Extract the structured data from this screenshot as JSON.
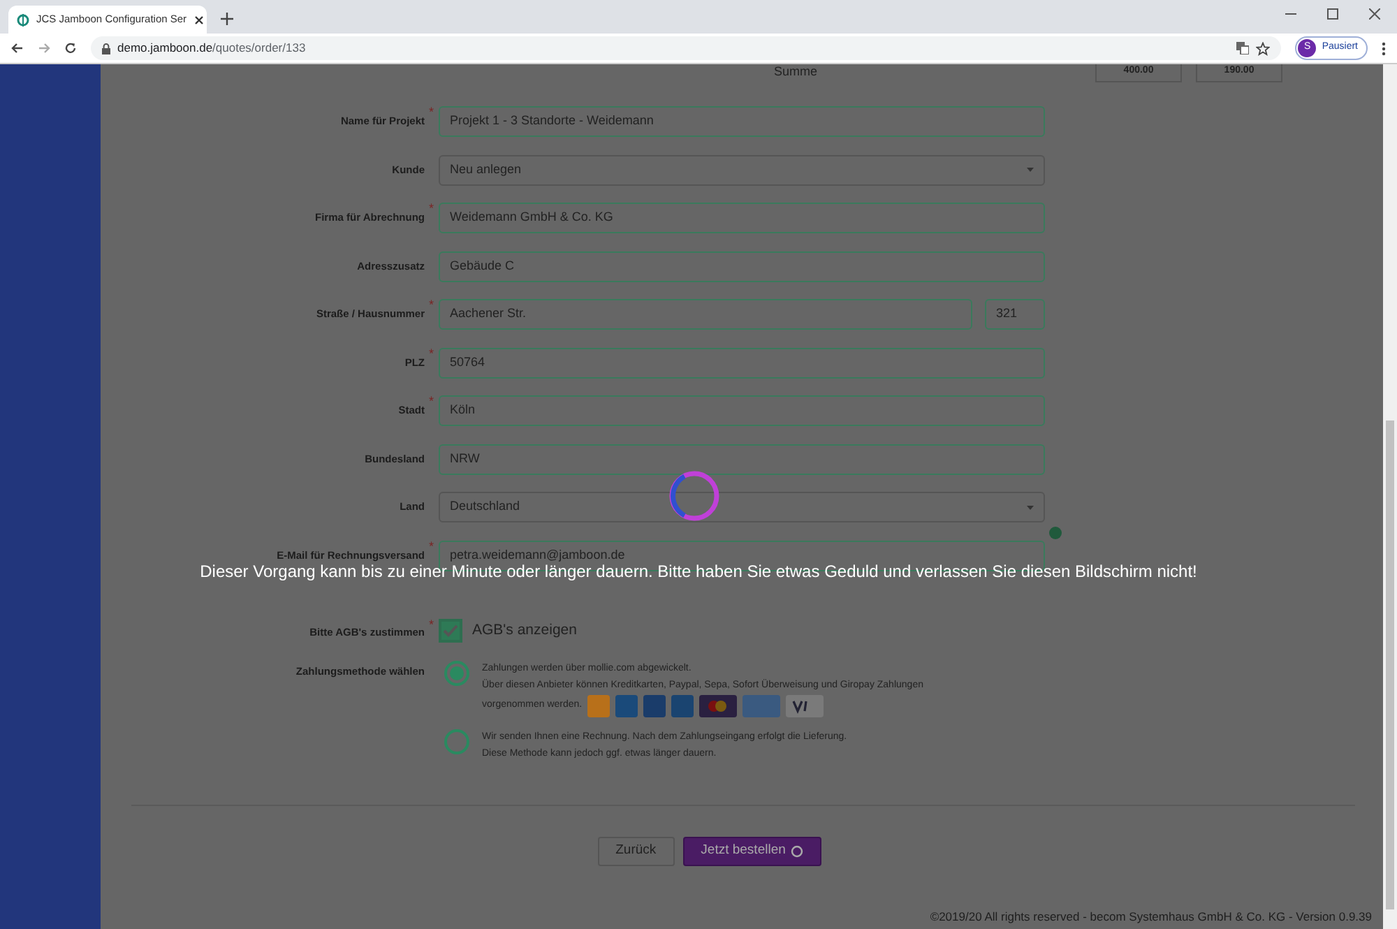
{
  "browser": {
    "tab_title": "JCS Jamboon Configuration Ser",
    "url_host": "demo.jamboon.de",
    "url_path": "/quotes/order/133",
    "profile_initial": "S",
    "profile_status": "Pausiert"
  },
  "required_mark": "*",
  "summary": {
    "label": "Summe",
    "values": [
      "400.00",
      "190.00"
    ]
  },
  "fields": [
    {
      "kind": "text",
      "label": "Name für Projekt",
      "required": true,
      "value": "Projekt 1 - 3 Standorte - Weidemann"
    },
    {
      "kind": "select",
      "label": "Kunde",
      "required": false,
      "value": "Neu anlegen"
    },
    {
      "kind": "text",
      "label": "Firma für Abrechnung",
      "required": true,
      "value": "Weidemann GmbH & Co. KG"
    },
    {
      "kind": "text",
      "label": "Adresszusatz",
      "required": false,
      "value": "Gebäude C"
    },
    {
      "kind": "split",
      "label": "Straße / Hausnummer",
      "required": true,
      "value": "Aachener Str.",
      "value2": "321"
    },
    {
      "kind": "text",
      "label": "PLZ",
      "required": true,
      "value": "50764"
    },
    {
      "kind": "text",
      "label": "Stadt",
      "required": true,
      "value": "Köln"
    },
    {
      "kind": "text",
      "label": "Bundesland",
      "required": false,
      "value": "NRW"
    },
    {
      "kind": "select",
      "label": "Land",
      "required": false,
      "value": "Deutschland"
    },
    {
      "kind": "help",
      "label": "E-Mail für Rechnungsversand",
      "required": true,
      "value": "petra.weidemann@jamboon.de"
    }
  ],
  "terms": {
    "label": "Bitte AGB's zustimmen",
    "required": true,
    "checked": true,
    "link": "AGB's anzeigen"
  },
  "payment": {
    "label": "Zahlungsmethode wählen",
    "options": [
      {
        "selected": true,
        "lines": [
          "Zahlungen werden über mollie.com abgewickelt.",
          "Über diesen Anbieter können Kreditkarten, Paypal, Sepa, Sofort Überweisung und Giropay Zahlungen",
          "vorgenommen werden."
        ],
        "logos": true
      },
      {
        "selected": false,
        "lines": [
          "Wir senden Ihnen eine Rechnung. Nach dem Zahlungseingang erfolgt die Lieferung.",
          "Diese Methode kann jedoch ggf. etwas länger dauern."
        ],
        "logos": false
      }
    ]
  },
  "buttons": {
    "back": "Zurück",
    "order": "Jetzt bestellen"
  },
  "overlay": {
    "message": "Dieser Vorgang kann bis zu einer Minute oder länger dauern. Bitte haben Sie etwas Geduld und verlassen Sie diesen Bildschirm nicht!"
  },
  "footer": "©2019/20 All rights reserved - becom Systemhaus GmbH & Co. KG - Version 0.9.39"
}
